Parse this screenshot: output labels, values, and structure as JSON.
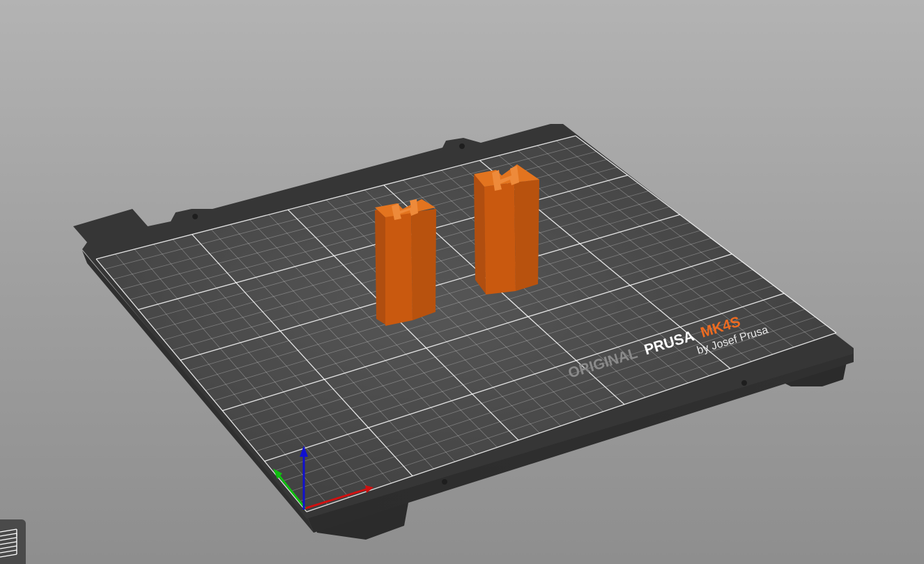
{
  "bed": {
    "brand_original": "ORIGINAL",
    "brand_prusa": "PRUSA",
    "brand_model": "MK4S",
    "brand_by": "by Josef Prusa"
  },
  "colors": {
    "bed_frame": "#3a3a3a",
    "bed_surface": "#444444",
    "grid_line": "#ffffff",
    "model_orange": "#ed6b21",
    "axis_x": "#d01010",
    "axis_y": "#10c010",
    "axis_z": "#1010d0",
    "layers_button": "#4a4a4a"
  },
  "toolbar": {
    "layers_icon": "layers-icon"
  }
}
